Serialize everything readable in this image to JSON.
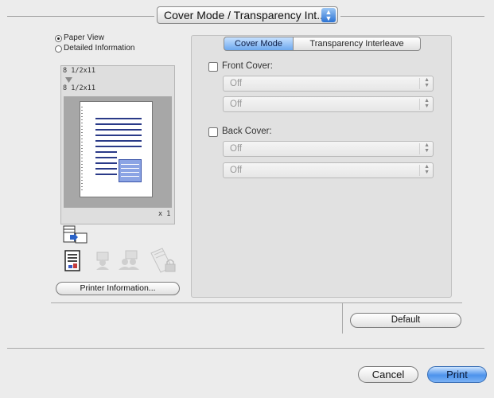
{
  "panel_popup": {
    "label": "Cover Mode / Transparency Int..."
  },
  "view_mode": {
    "options": [
      {
        "label": "Paper View",
        "selected": true
      },
      {
        "label": "Detailed Information",
        "selected": false
      }
    ]
  },
  "preview": {
    "original_size": "8 1/2x11",
    "output_size": "8 1/2x11",
    "copies": "x 1"
  },
  "printer_info_button": "Printer Information...",
  "tabs": [
    {
      "label": "Cover Mode",
      "active": true
    },
    {
      "label": "Transparency Interleave",
      "active": false
    }
  ],
  "front_cover": {
    "label": "Front Cover:",
    "checked": false,
    "selects": [
      "Off",
      "Off"
    ]
  },
  "back_cover": {
    "label": "Back Cover:",
    "checked": false,
    "selects": [
      "Off",
      "Off"
    ]
  },
  "default_button": "Default",
  "cancel_button": "Cancel",
  "print_button": "Print",
  "colors": {
    "accent": "#3b84e6",
    "panel": "#e1e1e1",
    "window": "#ececec"
  }
}
